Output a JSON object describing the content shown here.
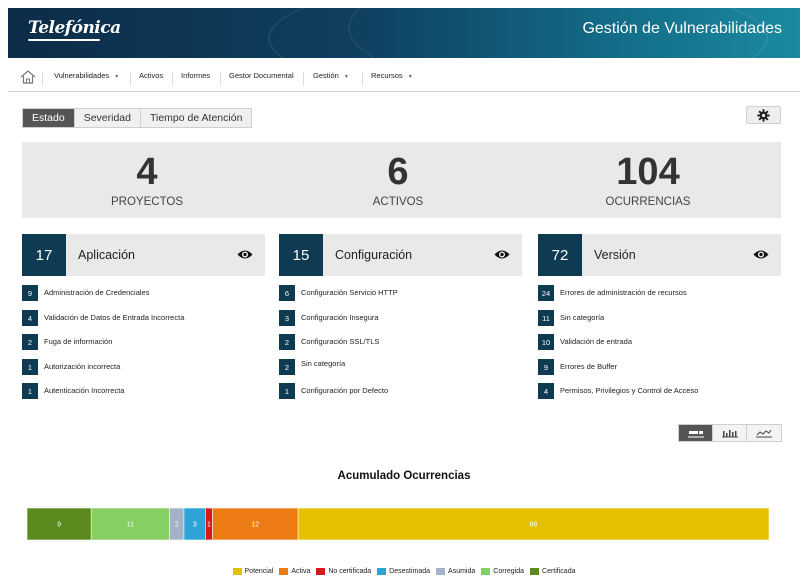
{
  "header": {
    "logo": "Telefónica",
    "title": "Gestión de Vulnerabilidades"
  },
  "nav": {
    "items": [
      {
        "label": "Vulnerabilidades",
        "dropdown": true
      },
      {
        "label": "Activos",
        "dropdown": false
      },
      {
        "label": "Informes",
        "dropdown": false
      },
      {
        "label": "Gestor Documental",
        "dropdown": false
      },
      {
        "label": "Gestión",
        "dropdown": true
      },
      {
        "label": "Recursos",
        "dropdown": true
      }
    ],
    "caret": "▾"
  },
  "tabs": [
    {
      "label": "Estado",
      "active": true
    },
    {
      "label": "Severidad",
      "active": false
    },
    {
      "label": "Tiempo de Atención",
      "active": false
    }
  ],
  "summary": {
    "proyectos": {
      "value": "4",
      "label": "PROYECTOS"
    },
    "activos": {
      "value": "6",
      "label": "ACTIVOS"
    },
    "ocurrencias": {
      "value": "104",
      "label": "OCURRENCIAS"
    }
  },
  "categories": [
    {
      "count": "17",
      "name": "Aplicación",
      "items": [
        {
          "count": "9",
          "label": "Administración de Credenciales"
        },
        {
          "count": "4",
          "label": "Validación de Datos de Entrada Incorrecta"
        },
        {
          "count": "2",
          "label": "Fuga de información"
        },
        {
          "count": "1",
          "label": "Autorización incorrecta"
        },
        {
          "count": "1",
          "label": "Autenticación Incorrecta"
        }
      ]
    },
    {
      "count": "15",
      "name": "Configuración",
      "items": [
        {
          "count": "6",
          "label": "Configuración Servicio HTTP"
        },
        {
          "count": "3",
          "label": "Configuración Insegura"
        },
        {
          "count": "2",
          "label": "Configuración SSL/TLS"
        },
        {
          "count": "2",
          "label": "Sin categoría"
        },
        {
          "count": "1",
          "label": "Configuración por Defecto"
        }
      ]
    },
    {
      "count": "72",
      "name": "Versión",
      "items": [
        {
          "count": "24",
          "label": "Errores de administración de recursos"
        },
        {
          "count": "11",
          "label": "Sin categoría"
        },
        {
          "count": "10",
          "label": "Validación de entrada"
        },
        {
          "count": "9",
          "label": "Errores de Buffer"
        },
        {
          "count": "4",
          "label": "Permisos, Privilegios y Control de Acceso"
        }
      ]
    }
  ],
  "chart_buttons": [
    {
      "icon": "stacked-bar-icon",
      "active": true
    },
    {
      "icon": "bar-chart-icon",
      "active": false
    },
    {
      "icon": "line-chart-icon",
      "active": false
    }
  ],
  "colors": {
    "dark_teal": "#0e3a52",
    "certificada": "#5b8a1e",
    "corregida": "#86cf62",
    "asumida": "#a3b2c8",
    "desestimada": "#2ea3d8",
    "no_certificada": "#d7191c",
    "activa": "#ec7b14",
    "potencial": "#e3c000"
  },
  "chart_data": {
    "type": "bar",
    "title": "Acumulado Ocurrencias",
    "orientation": "horizontal-stacked",
    "total": 104,
    "series": [
      {
        "name": "Certificada",
        "value": 9,
        "color": "#5b8a1e"
      },
      {
        "name": "Corregida",
        "value": 11,
        "color": "#86cf62"
      },
      {
        "name": "Asumida",
        "value": 2,
        "color": "#a3b2c8"
      },
      {
        "name": "Desestimada",
        "value": 3,
        "color": "#2ea3d8"
      },
      {
        "name": "No certificada",
        "value": 1,
        "color": "#d7191c"
      },
      {
        "name": "Activa",
        "value": 12,
        "color": "#ec7b14"
      },
      {
        "name": "Potencial",
        "value": 66,
        "color": "#e3c000"
      }
    ],
    "legend": [
      "Potencial",
      "Activa",
      "No certificada",
      "Desestimada",
      "Asumida",
      "Corregida",
      "Certificada"
    ],
    "legend_placement": "bottom"
  }
}
